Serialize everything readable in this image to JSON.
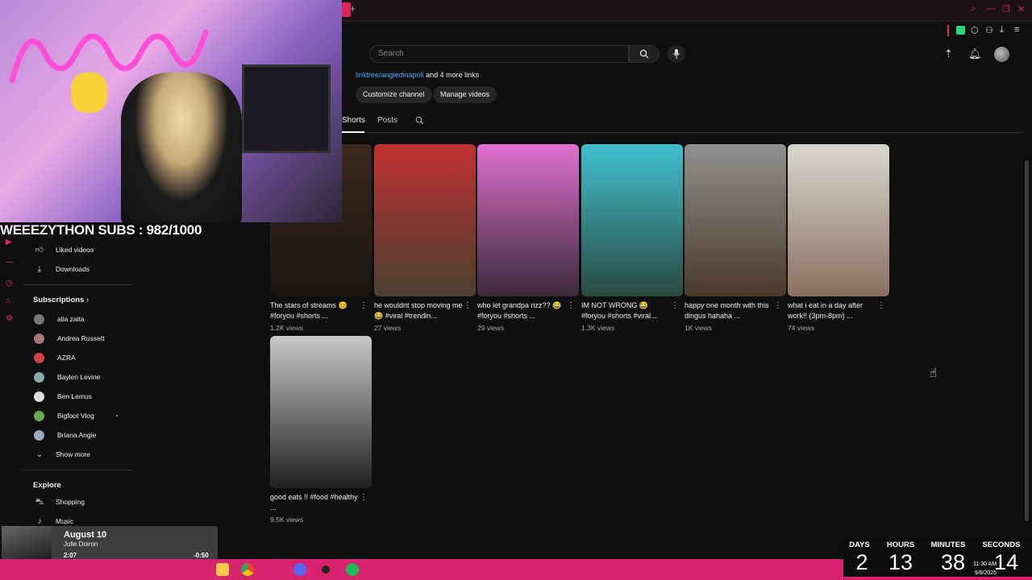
{
  "browser": {
    "newtab_symbol": "+",
    "win_controls": [
      "⌕",
      "—",
      "❐",
      "✕"
    ]
  },
  "header": {
    "search_placeholder": "Search"
  },
  "channel": {
    "link_text": "linktree/angiedinapoli",
    "link_suffix": "and 4 more links",
    "customize_label": "Customize channel",
    "manage_label": "Manage videos"
  },
  "tabs": {
    "shorts": "Shorts",
    "posts": "Posts"
  },
  "sidebar": {
    "liked": "Liked videos",
    "downloads": "Downloads",
    "subscriptions_head": "Subscriptions",
    "subs": [
      "alia zaita",
      "Andrea Russett",
      "AZRA",
      "Baylen Levine",
      "Ben Lemus",
      "Bigfoot Vlog",
      "Briana Angie"
    ],
    "show_more": "Show more",
    "explore_head": "Explore",
    "shopping": "Shopping",
    "music": "Music"
  },
  "shorts": [
    {
      "title": "The stars of streams 😊 #foryou #shorts ...",
      "views": "1.2K views",
      "color_a": "#3a2a20",
      "color_b": "#1a1410"
    },
    {
      "title": "he wouldnt stop moving me 😂 #viral #trendin...",
      "views": "27 views",
      "color_a": "#c03030",
      "color_b": "#4a4030"
    },
    {
      "title": "who let grandpa rizz?? 😂 #foryou #shorts ...",
      "views": "29 views",
      "color_a": "#e070d0",
      "color_b": "#3a2a3a"
    },
    {
      "title": "IM NOT WRONG 😂 #foryou #shorts #viral...",
      "views": "1.3K views",
      "color_a": "#40c0d0",
      "color_b": "#2a4a40"
    },
    {
      "title": "happy one month with this dingus hahaha ...",
      "views": "1K views",
      "color_a": "#909090",
      "color_b": "#4a3a2a"
    },
    {
      "title": "what i eat in a day after work!! (3pm-8pm) ...",
      "views": "74 views",
      "color_a": "#d8d8d0",
      "color_b": "#8a7060"
    },
    {
      "title": "good eats !! #food #healthy ...",
      "views": "9.5K views",
      "color_a": "#c8c8c8",
      "color_b": "#202020"
    }
  ],
  "overlay": {
    "subs_text": "WEEEZYTHON SUBS : 982/1000",
    "track_title": "August 10",
    "track_artist": "Julie Doiron",
    "elapsed": "2:07",
    "remaining": "-0:50",
    "progress": 0.71
  },
  "countdown": {
    "labels": [
      "DAYS",
      "HOURS",
      "MINUTES",
      "SECONDS"
    ],
    "values": [
      "2",
      "13",
      "38",
      "14"
    ]
  },
  "clock": {
    "time": "11:30 AM",
    "date": "9/6/2025"
  },
  "colors": {
    "accent": "#e0245e",
    "link": "#3ea6ff"
  }
}
